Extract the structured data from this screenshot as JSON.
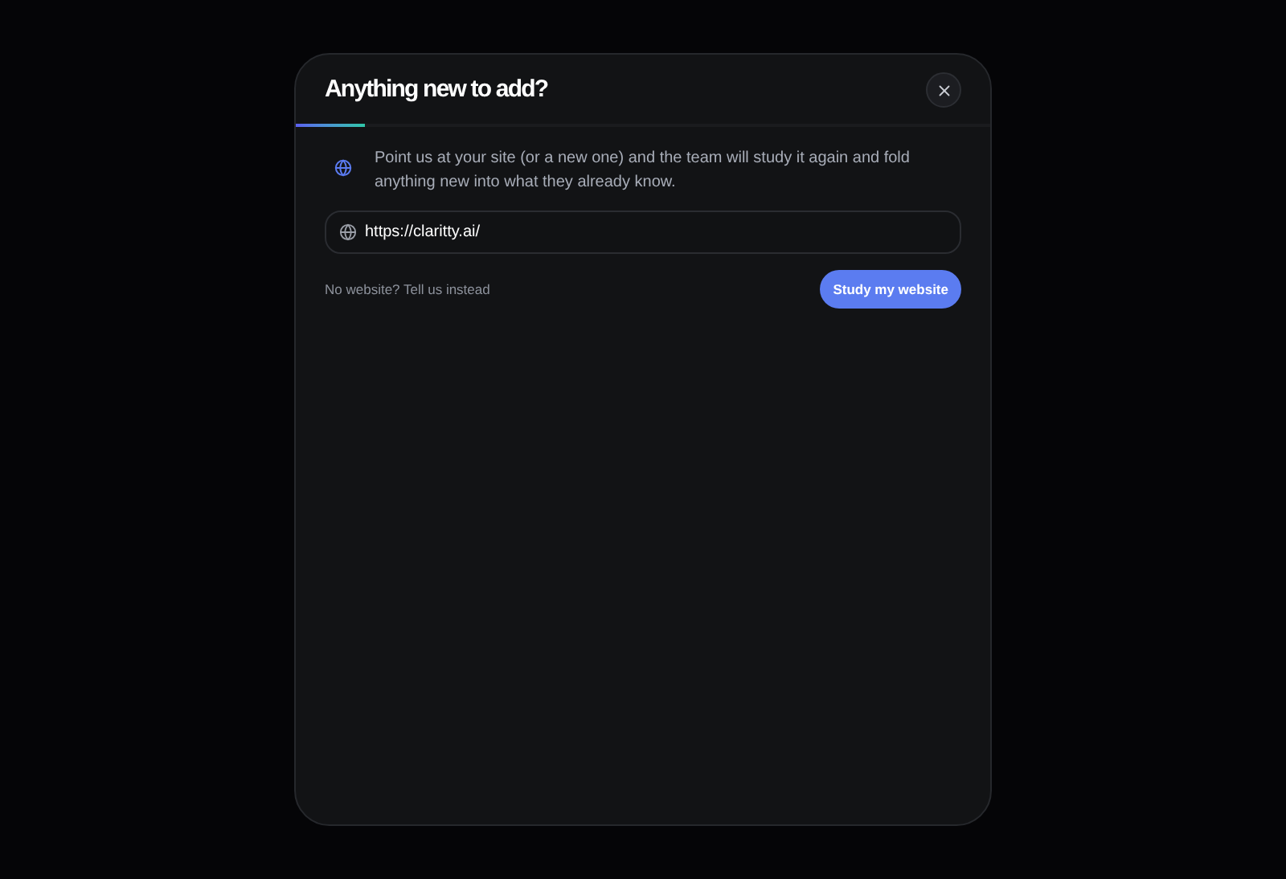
{
  "dialog": {
    "title": "Anything new to add?",
    "progress": {
      "level": 0.1
    },
    "intro": "Point us at your site (or a new one) and the team will study it again and fold anything new into what they already know.",
    "url_field": {
      "value": "https://claritty.ai/"
    },
    "alt_link": "No website? Tell us instead",
    "submit": "Study my website"
  }
}
